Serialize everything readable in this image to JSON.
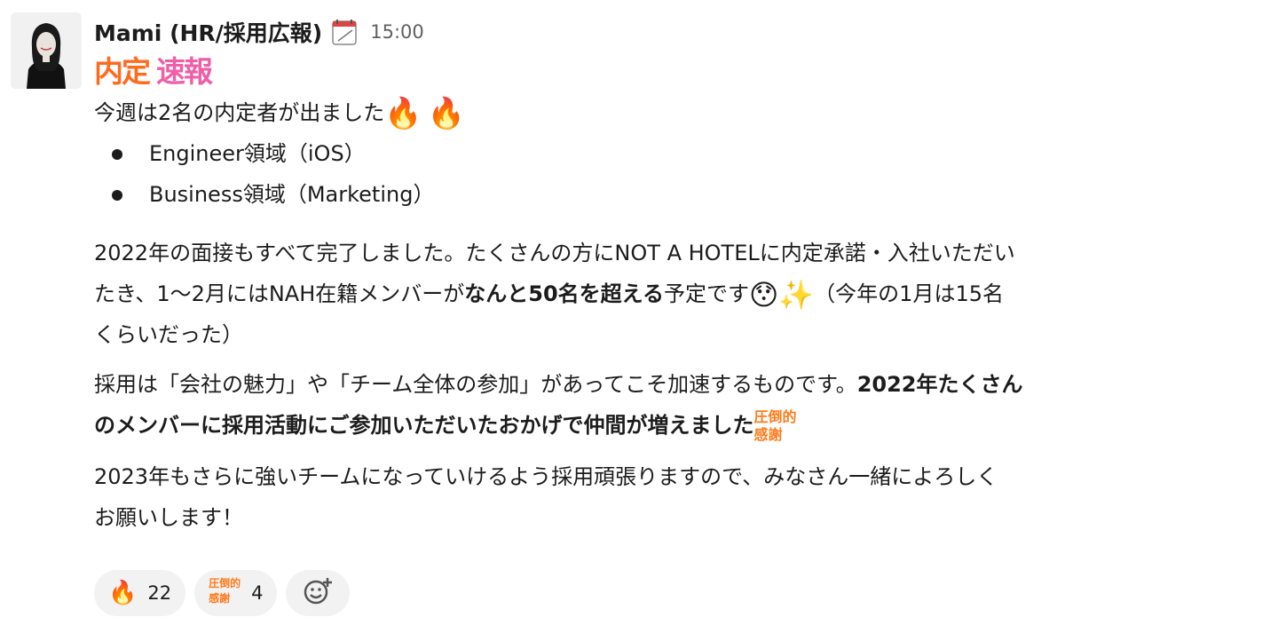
{
  "message": {
    "author": "Mami (HR/採用広報)",
    "status_icon": "calendar-icon",
    "time": "15:00",
    "stamp_left": "内定",
    "stamp_right": "速報",
    "intro": "今週は2名の内定者が出ました",
    "intro_emoji": "🔥",
    "bullets": [
      "Engineer領域（iOS）",
      "Business領域（Marketing）"
    ],
    "p1_l1": "2022年の面接もすべて完了しました。たくさんの方にNOT A HOTELに内定承諾・入社いただい",
    "p1_l2_pre": "たき、1〜2月にはNAH在籍メンバーが",
    "p1_l2_bold": "なんと50名を超える",
    "p1_l2_post": "予定です",
    "p1_emoji_a": "😯",
    "p1_emoji_b": "✨",
    "p1_l2_tail": "（今年の1月は15名",
    "p1_l3": "くらいだった）",
    "p2_l1_pre": "採用は「会社の魅力」や「チーム全体の参加」があってこそ加速するものです。",
    "p2_l1_bold": "2022年たくさん",
    "p2_l2_bold": "のメンバーに採用活動にご参加いただいたおかげで仲間が増えました",
    "gratitude_stamp_top": "圧倒的",
    "gratitude_stamp_bottom": "感謝",
    "p3_l1": "2023年もさらに強いチームになっていけるよう採用頑張りますので、みなさん一緒によろしく",
    "p3_l2": "お願いします！"
  },
  "reactions": [
    {
      "emoji": "🔥",
      "count": "22"
    },
    {
      "stamp_top": "圧倒的",
      "stamp_bottom": "感謝",
      "count": "4"
    }
  ],
  "add_reaction_icon": "add-reaction-icon"
}
